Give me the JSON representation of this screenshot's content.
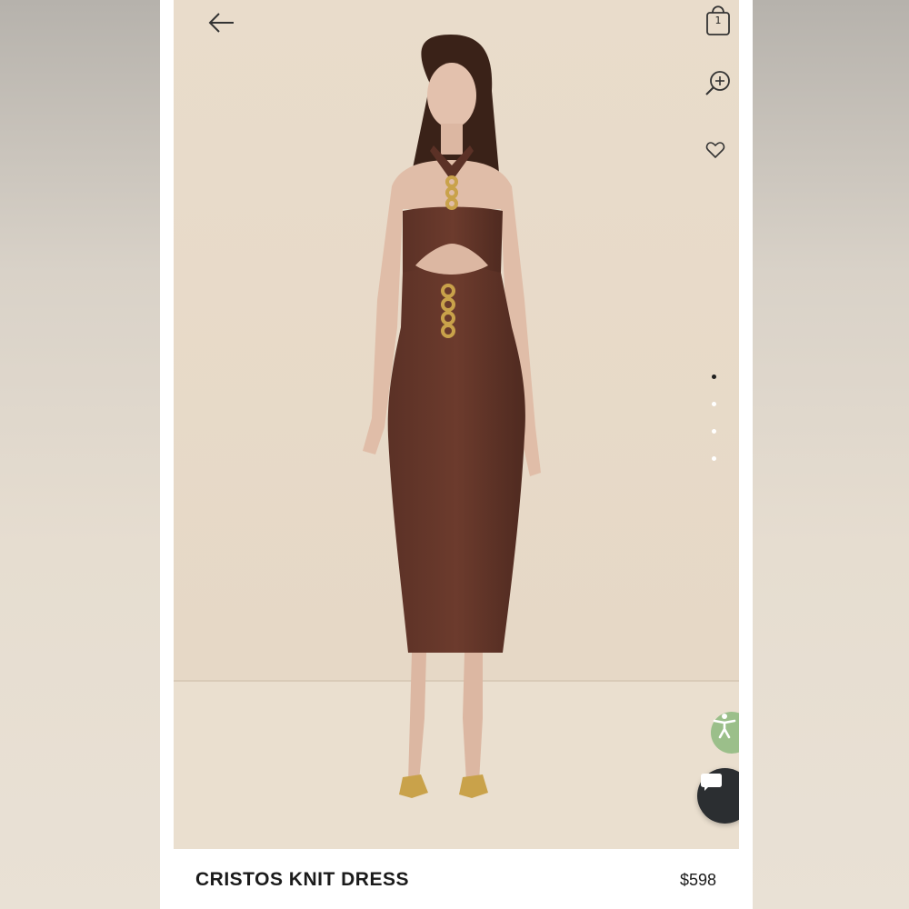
{
  "header": {
    "back_icon": "arrow-left-icon",
    "bag_icon": "shopping-bag-icon",
    "bag_count": "1",
    "zoom_icon": "zoom-in-icon",
    "wishlist_icon": "heart-icon"
  },
  "gallery": {
    "image": "model wearing brown halter dress with gold chain details",
    "slides": 4,
    "active_slide": 1
  },
  "accessibility": {
    "icon": "accessibility-icon",
    "color": "#9bbf8a"
  },
  "chat": {
    "icon": "chat-bubble-icon",
    "color": "#2b2e31"
  },
  "product": {
    "name": "CRISTOS KNIT DRESS",
    "price": "$598"
  }
}
